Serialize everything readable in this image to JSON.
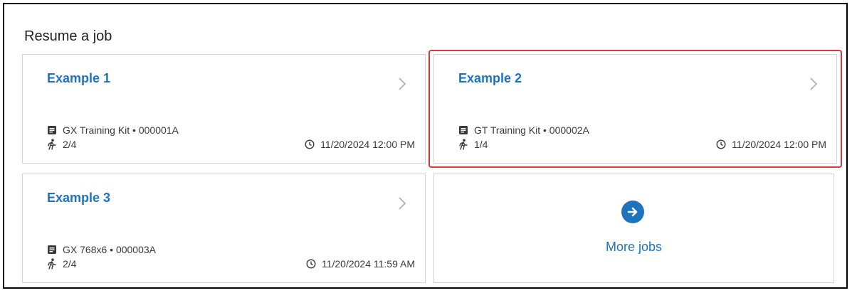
{
  "section": {
    "title": "Resume a job"
  },
  "jobs": [
    {
      "name": "Example 1",
      "kit": "GX Training Kit • 000001A",
      "progress": "2/4",
      "datetime": "11/20/2024 12:00 PM"
    },
    {
      "name": "Example 2",
      "kit": "GT Training Kit • 000002A",
      "progress": "1/4",
      "datetime": "11/20/2024 12:00 PM"
    },
    {
      "name": "Example 3",
      "kit": "GX 768x6 • 000003A",
      "progress": "2/4",
      "datetime": "11/20/2024 11:59 AM"
    }
  ],
  "more": {
    "label": "More jobs"
  },
  "colors": {
    "accent": "#1e73be",
    "highlight": "#d9363e",
    "border": "#d4d4d4"
  },
  "icons": {
    "kit": "document-icon",
    "progress": "walking-person-icon",
    "time": "clock-icon",
    "open": "chevron-right-icon",
    "more": "arrow-right-circle-icon"
  }
}
